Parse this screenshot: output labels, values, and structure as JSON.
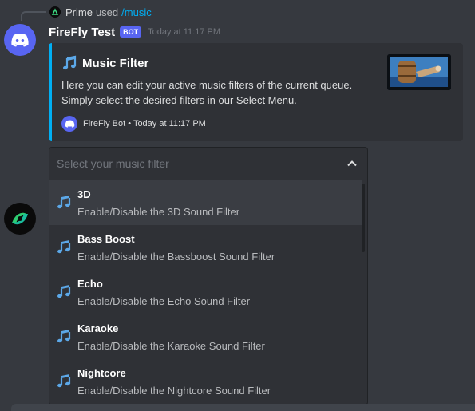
{
  "reply": {
    "user": "Prime",
    "used_text": "used",
    "command": "/music"
  },
  "message": {
    "username": "FireFly Test",
    "bot_tag": "BOT",
    "timestamp": "Today at 11:17 PM"
  },
  "embed": {
    "title": "Music Filter",
    "description": "Here you can edit your active music filters of the current queue. Simply select the desired filters in our Select Menu.",
    "footer": "FireFly Bot • Today at 11:17 PM",
    "accent_color": "#00aff4"
  },
  "select": {
    "placeholder": "Select your music filter",
    "options": [
      {
        "label": "3D",
        "description": "Enable/Disable the 3D Sound Filter"
      },
      {
        "label": "Bass Boost",
        "description": "Enable/Disable the Bassboost Sound Filter"
      },
      {
        "label": "Echo",
        "description": "Enable/Disable the Echo Sound Filter"
      },
      {
        "label": "Karaoke",
        "description": "Enable/Disable the Karaoke Sound Filter"
      },
      {
        "label": "Nightcore",
        "description": "Enable/Disable the Nightcore Sound Filter"
      }
    ]
  },
  "icons": {
    "avatar": "discord-logo-icon",
    "option": "music-note-icon",
    "chevron": "chevron-up-icon"
  },
  "colors": {
    "blurple": "#5865f2",
    "note_blue": "#5ca8e8"
  }
}
